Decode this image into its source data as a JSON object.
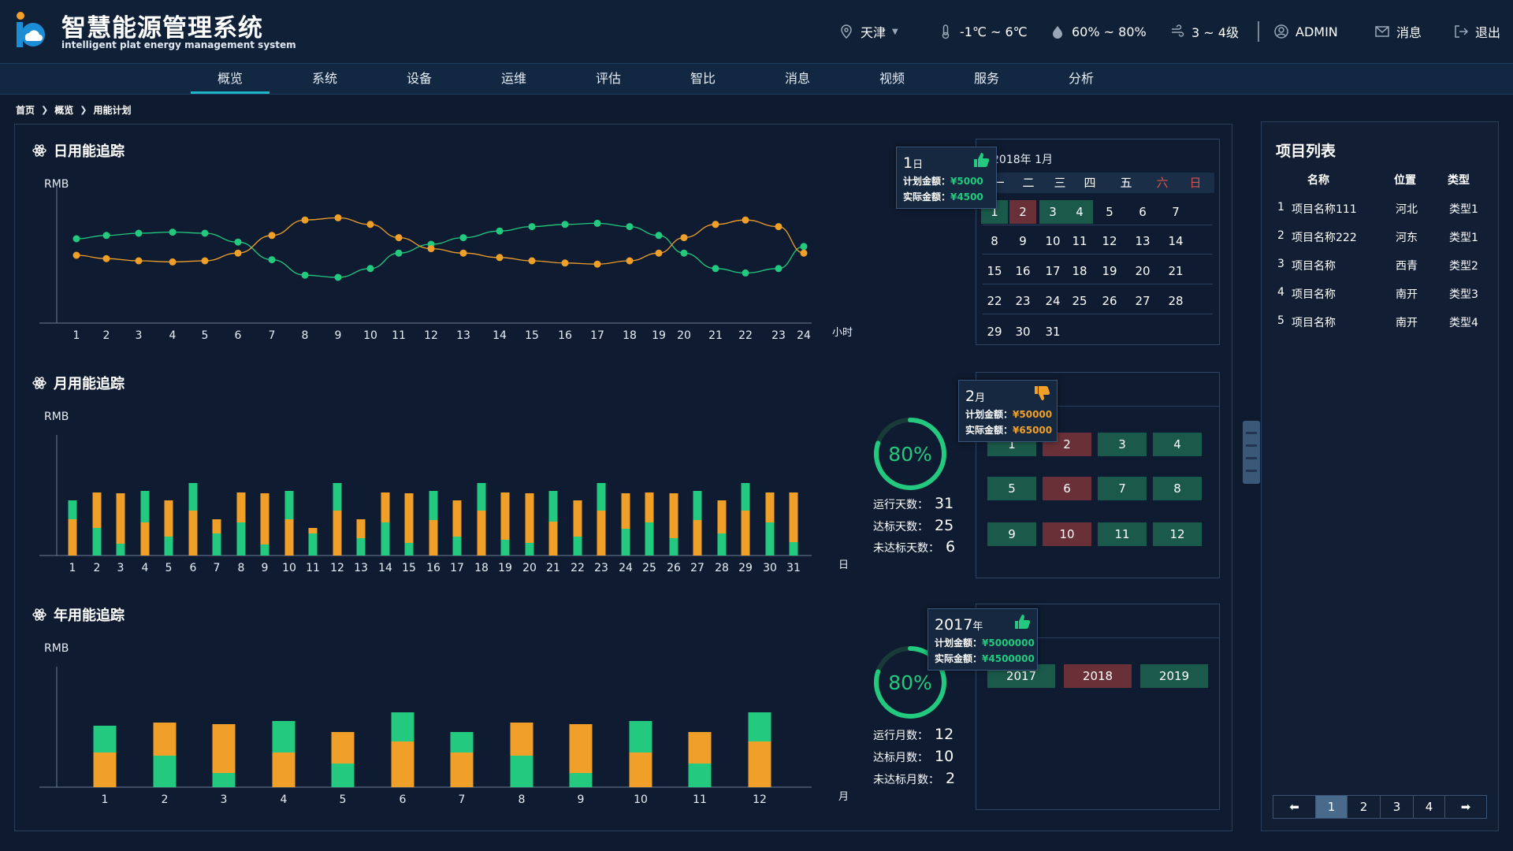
{
  "header": {
    "title": "智慧能源管理系统",
    "subtitle": "intelligent plat energy management system",
    "city": "天津",
    "temperature": "-1℃ ~ 6℃",
    "humidity": "60% ~ 80%",
    "wind": "3 ~ 4级",
    "user": "ADMIN",
    "messages": "消息",
    "logout": "退出"
  },
  "nav": [
    "概览",
    "系统",
    "设备",
    "运维",
    "评估",
    "智比",
    "消息",
    "视频",
    "服务",
    "分析"
  ],
  "breadcrumb": [
    "首页",
    "概览",
    "用能计划"
  ],
  "colors": {
    "plan": "#f0a028",
    "actual": "#22c97e",
    "hit": "#1b5a4a",
    "miss": "#6a3038",
    "accent": "#1fb4c9"
  },
  "daily": {
    "title": "日用能追踪",
    "unit": "RMB",
    "x_unit": "小时",
    "calendar_title": "2018年 1月",
    "weekdays": [
      "一",
      "二",
      "三",
      "四",
      "五",
      "六",
      "日"
    ],
    "tooltip": {
      "big": "1",
      "small": "日",
      "plan_label": "计划金额：",
      "plan_value": "¥5000",
      "actual_label": "实际金额：",
      "actual_value": "¥4500"
    }
  },
  "monthly": {
    "title": "月用能追踪",
    "unit": "RMB",
    "x_unit": "日",
    "donut_percent": "80%",
    "stats": [
      {
        "label": "运行天数：",
        "value": "31"
      },
      {
        "label": "达标天数：",
        "value": "25"
      },
      {
        "label": "未达标天数：",
        "value": "6"
      }
    ],
    "tooltip": {
      "big": "2",
      "small": "月",
      "plan_label": "计划金额：",
      "plan_value": "¥50000",
      "actual_label": "实际金额：",
      "actual_value": "¥65000"
    }
  },
  "yearly": {
    "title": "年用能追踪",
    "unit": "RMB",
    "x_unit": "月",
    "donut_percent": "80%",
    "stats": [
      {
        "label": "运行月数：",
        "value": "12"
      },
      {
        "label": "达标月数：",
        "value": "10"
      },
      {
        "label": "未达标月数：",
        "value": "2"
      }
    ],
    "years": [
      "2017",
      "2018",
      "2019"
    ],
    "tooltip": {
      "big": "2017",
      "small": "年",
      "plan_label": "计划金额：",
      "plan_value": "¥5000000",
      "actual_label": "实际金额：",
      "actual_value": "¥4500000"
    }
  },
  "projects": {
    "title": "项目列表",
    "headers": [
      "名称",
      "位置",
      "类型"
    ],
    "rows": [
      {
        "no": "1",
        "name": "项目名称111",
        "location": "河北",
        "type": "类型1"
      },
      {
        "no": "2",
        "name": "项目名称222",
        "location": "河东",
        "type": "类型1"
      },
      {
        "no": "3",
        "name": "项目名称",
        "location": "西青",
        "type": "类型2"
      },
      {
        "no": "4",
        "name": "项目名称",
        "location": "南开",
        "type": "类型3"
      },
      {
        "no": "5",
        "name": "项目名称",
        "location": "南开",
        "type": "类型4"
      }
    ],
    "pages": [
      "1",
      "2",
      "3",
      "4"
    ]
  },
  "chart_data": [
    {
      "type": "line",
      "x": [
        1,
        2,
        3,
        4,
        5,
        6,
        7,
        8,
        9,
        10,
        11,
        12,
        13,
        14,
        15,
        16,
        17,
        18,
        19,
        20,
        21,
        22,
        23,
        24
      ],
      "series": [
        {
          "color": "#22c97e",
          "values": [
            55,
            58,
            60,
            61,
            60,
            52,
            36,
            22,
            20,
            28,
            42,
            50,
            56,
            62,
            66,
            68,
            69,
            66,
            58,
            42,
            28,
            24,
            28,
            48
          ]
        },
        {
          "color": "#f0a028",
          "values": [
            40,
            37,
            35,
            34,
            35,
            42,
            58,
            72,
            74,
            68,
            56,
            46,
            42,
            38,
            35,
            33,
            32,
            35,
            42,
            56,
            68,
            72,
            66,
            42
          ]
        }
      ]
    },
    {
      "type": "bar",
      "x": [
        1,
        2,
        3,
        4,
        5,
        6,
        7,
        8,
        9,
        10,
        11,
        12,
        13,
        14,
        15,
        16,
        17,
        18,
        19,
        20,
        21,
        22,
        23,
        24,
        25,
        26,
        27,
        28,
        29,
        30,
        31
      ],
      "series": [
        {
          "color": "#22c97e",
          "values": [
            70,
            35,
            15,
            82,
            24,
            92,
            28,
            42,
            14,
            82,
            28,
            92,
            22,
            42,
            16,
            82,
            24,
            92,
            20,
            16,
            82,
            24,
            92,
            34,
            42,
            22,
            82,
            28,
            92,
            42,
            17
          ]
        },
        {
          "color": "#f0a028",
          "values": [
            46,
            80,
            79,
            42,
            70,
            57,
            46,
            80,
            79,
            46,
            35,
            57,
            46,
            80,
            79,
            45,
            70,
            57,
            80,
            79,
            43,
            70,
            57,
            79,
            80,
            79,
            45,
            70,
            57,
            80,
            80
          ]
        }
      ]
    },
    {
      "type": "bar",
      "x": [
        1,
        2,
        3,
        4,
        5,
        6,
        7,
        8,
        9,
        10,
        11,
        12
      ],
      "series": [
        {
          "color": "#22c97e",
          "values": [
            78,
            40,
            18,
            84,
            30,
            95,
            70,
            40,
            18,
            84,
            30,
            95
          ]
        },
        {
          "color": "#f0a028",
          "values": [
            44,
            82,
            80,
            44,
            70,
            58,
            44,
            82,
            80,
            44,
            70,
            58
          ]
        }
      ]
    }
  ]
}
